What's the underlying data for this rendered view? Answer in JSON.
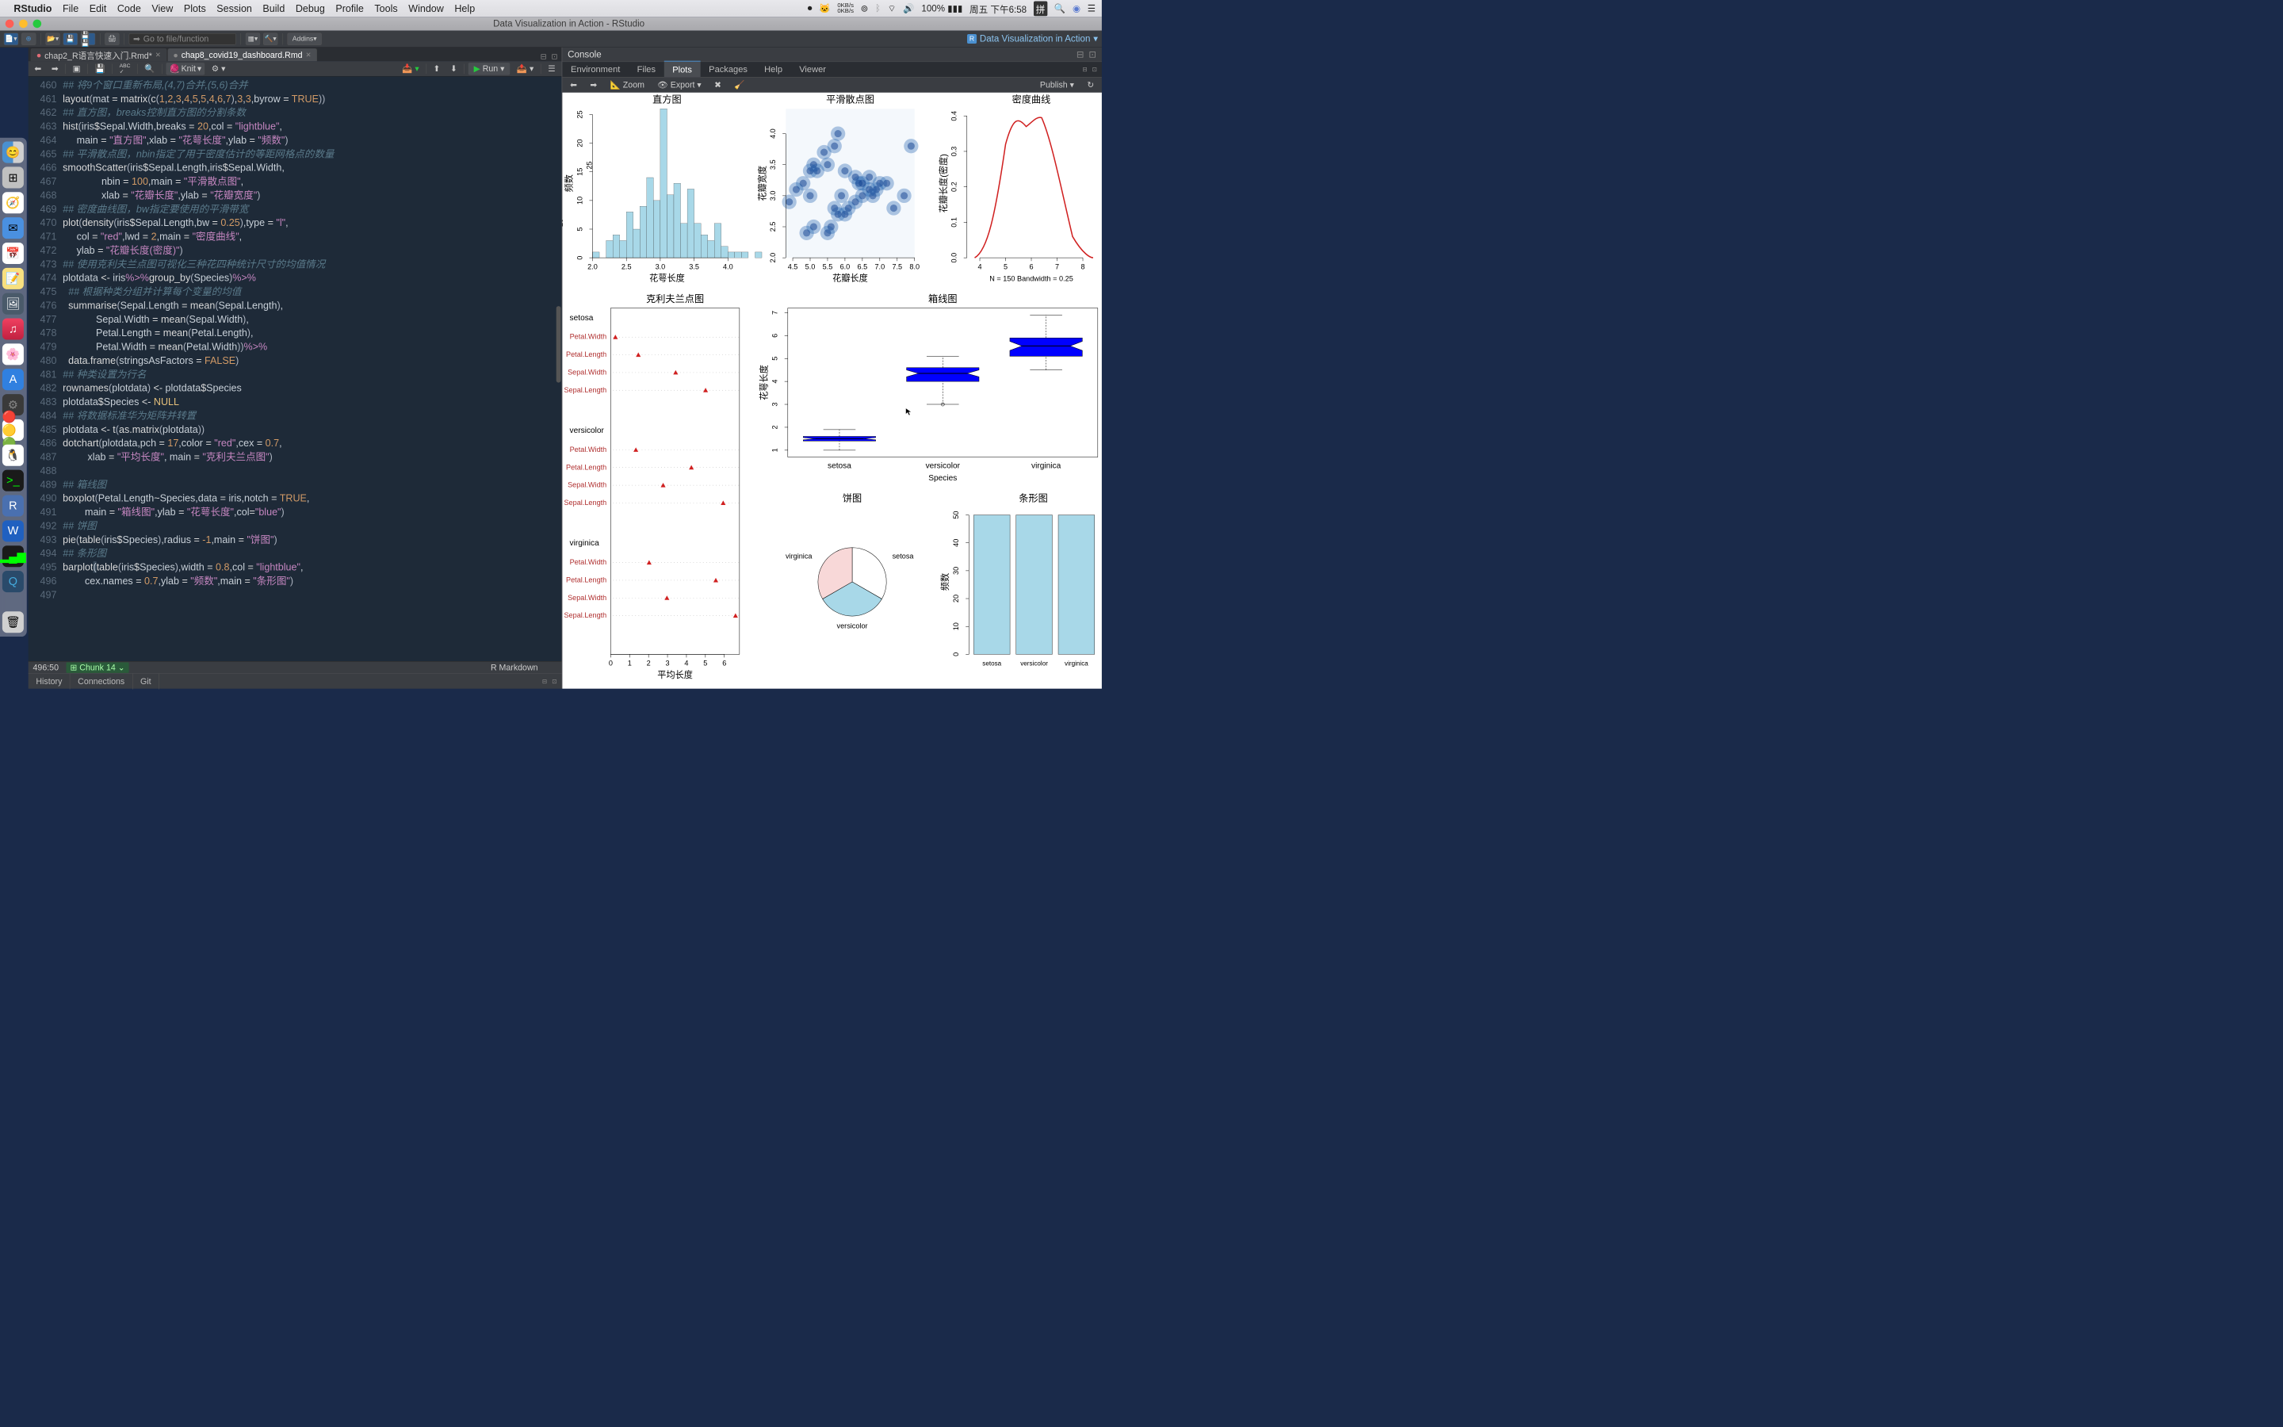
{
  "menubar": {
    "app_name": "RStudio",
    "items": [
      "File",
      "Edit",
      "Code",
      "View",
      "Plots",
      "Session",
      "Build",
      "Debug",
      "Profile",
      "Tools",
      "Window",
      "Help"
    ],
    "status": {
      "net_up": "0KB/s",
      "net_down": "0KB/s",
      "battery": "100%",
      "datetime": "周五 下午6:58",
      "ime": "拼"
    }
  },
  "titlebar": {
    "title": "Data Visualization in Action - RStudio"
  },
  "toolbar": {
    "goto_placeholder": "Go to file/function",
    "addins_label": "Addins",
    "project_label": "Data Visualization in Action"
  },
  "source_tabs": {
    "tab1": "chap2_R语言快速入门.Rmd*",
    "tab2": "chap8_covid19_dashboard.Rmd"
  },
  "editor_toolbar": {
    "knit": "Knit",
    "run": "Run"
  },
  "cursor_pos": "496:50",
  "chunk_label": "Chunk 14",
  "file_lang": "R Markdown",
  "bottom_tabs": [
    "History",
    "Connections",
    "Git"
  ],
  "console": {
    "title": "Console"
  },
  "right_tabs": [
    "Environment",
    "Files",
    "Plots",
    "Packages",
    "Help",
    "Viewer"
  ],
  "plots_toolbar": {
    "zoom": "Zoom",
    "export": "Export",
    "publish": "Publish"
  },
  "code": [
    {
      "n": 460,
      "type": "comment",
      "text": "## 将9个窗口重新布局,(4,7)合并,(5,6)合并"
    },
    {
      "n": 461,
      "html": "<span class='c-func'>layout</span><span class='c-punct'>(</span>mat <span class='c-op'>=</span> <span class='c-func'>matrix</span><span class='c-punct'>(</span><span class='c-func'>c</span><span class='c-punct'>(</span><span class='c-number'>1</span>,<span class='c-number'>2</span>,<span class='c-number'>3</span>,<span class='c-number'>4</span>,<span class='c-number'>5</span>,<span class='c-number'>5</span>,<span class='c-number'>4</span>,<span class='c-number'>6</span>,<span class='c-number'>7</span><span class='c-punct'>)</span>,<span class='c-number'>3</span>,<span class='c-number'>3</span>,byrow <span class='c-op'>=</span> <span class='c-true'>TRUE</span><span class='c-punct'>))</span>"
    },
    {
      "n": 462,
      "type": "comment",
      "text": "## 直方图，breaks控制直方图的分割条数"
    },
    {
      "n": 463,
      "html": "<span class='c-func'>hist</span><span class='c-punct'>(</span>iris<span class='c-op'>$</span>Sepal.Width,breaks <span class='c-op'>=</span> <span class='c-number'>20</span>,col <span class='c-op'>=</span> <span class='c-string'>\"lightblue\"</span>,"
    },
    {
      "n": 464,
      "html": "     main <span class='c-op'>=</span> <span class='c-string'>\"直方图\"</span>,xlab <span class='c-op'>=</span> <span class='c-string'>\"花萼长度\"</span>,ylab <span class='c-op'>=</span> <span class='c-string'>\"频数\"</span><span class='c-punct'>)</span>"
    },
    {
      "n": 465,
      "type": "comment",
      "text": "## 平滑散点图，nbin指定了用于密度估计的等距网格点的数量"
    },
    {
      "n": 466,
      "html": "<span class='c-func'>smoothScatter</span><span class='c-punct'>(</span>iris<span class='c-op'>$</span>Sepal.Length,iris<span class='c-op'>$</span>Sepal.Width,"
    },
    {
      "n": 467,
      "html": "              nbin <span class='c-op'>=</span> <span class='c-number'>100</span>,main <span class='c-op'>=</span> <span class='c-string'>\"平滑散点图\"</span>,"
    },
    {
      "n": 468,
      "html": "              xlab <span class='c-op'>=</span> <span class='c-string'>\"花瓣长度\"</span>,ylab <span class='c-op'>=</span> <span class='c-string'>\"花瓣宽度\"</span><span class='c-punct'>)</span>"
    },
    {
      "n": 469,
      "type": "comment",
      "text": "## 密度曲线图，bw指定要使用的平滑带宽"
    },
    {
      "n": 470,
      "html": "<span class='c-func'>plot</span><span class='c-punct'>(</span><span class='c-func'>density</span><span class='c-punct'>(</span>iris<span class='c-op'>$</span>Sepal.Length,bw <span class='c-op'>=</span> <span class='c-number'>0.25</span><span class='c-punct'>)</span>,type <span class='c-op'>=</span> <span class='c-string'>\"l\"</span>,"
    },
    {
      "n": 471,
      "html": "     col <span class='c-op'>=</span> <span class='c-string'>\"red\"</span>,lwd <span class='c-op'>=</span> <span class='c-number'>2</span>,main <span class='c-op'>=</span> <span class='c-string'>\"密度曲线\"</span>,"
    },
    {
      "n": 472,
      "html": "     ylab <span class='c-op'>=</span> <span class='c-string'>\"花瓣长度(密度)\"</span><span class='c-punct'>)</span>"
    },
    {
      "n": 473,
      "type": "comment",
      "text": "## 使用克利夫兰点图可视化三种花四种统计尺寸的均值情况"
    },
    {
      "n": 474,
      "html": "plotdata <span class='c-op'>&lt;-</span> iris<span class='c-pipe'>%&gt;%</span><span class='c-func'>group_by</span><span class='c-punct'>(</span>Species<span class='c-punct'>)</span><span class='c-pipe'>%&gt;%</span>"
    },
    {
      "n": 475,
      "type": "comment",
      "text": "  ## 根据种类分组并计算每个变量的均值"
    },
    {
      "n": 476,
      "html": "  <span class='c-func'>summarise</span><span class='c-punct'>(</span>Sepal.Length <span class='c-op'>=</span> <span class='c-func'>mean</span><span class='c-punct'>(</span>Sepal.Length<span class='c-punct'>)</span>,"
    },
    {
      "n": 477,
      "html": "            Sepal.Width <span class='c-op'>=</span> <span class='c-func'>mean</span><span class='c-punct'>(</span>Sepal.Width<span class='c-punct'>)</span>,"
    },
    {
      "n": 478,
      "html": "            Petal.Length <span class='c-op'>=</span> <span class='c-func'>mean</span><span class='c-punct'>(</span>Petal.Length<span class='c-punct'>)</span>,"
    },
    {
      "n": 479,
      "html": "            Petal.Width <span class='c-op'>=</span> <span class='c-func'>mean</span><span class='c-punct'>(</span>Petal.Width<span class='c-punct'>))</span><span class='c-pipe'>%&gt;%</span>"
    },
    {
      "n": 480,
      "html": "  <span class='c-func'>data.frame</span><span class='c-punct'>(</span>stringsAsFactors <span class='c-op'>=</span> <span class='c-true'>FALSE</span><span class='c-punct'>)</span>"
    },
    {
      "n": 481,
      "type": "comment",
      "text": "## 种类设置为行名"
    },
    {
      "n": 482,
      "html": "<span class='c-func'>rownames</span><span class='c-punct'>(</span>plotdata<span class='c-punct'>)</span> <span class='c-op'>&lt;-</span> plotdata<span class='c-op'>$</span>Species"
    },
    {
      "n": 483,
      "html": "plotdata<span class='c-op'>$</span>Species <span class='c-op'>&lt;-</span> <span class='c-const'>NULL</span>"
    },
    {
      "n": 484,
      "type": "comment",
      "text": "## 将数据标准华为矩阵并转置"
    },
    {
      "n": 485,
      "html": "plotdata <span class='c-op'>&lt;-</span> <span class='c-func'>t</span><span class='c-punct'>(</span><span class='c-func'>as.matrix</span><span class='c-punct'>(</span>plotdata<span class='c-punct'>))</span>"
    },
    {
      "n": 486,
      "html": "<span class='c-func'>dotchart</span><span class='c-punct'>(</span>plotdata,pch <span class='c-op'>=</span> <span class='c-number'>17</span>,color <span class='c-op'>=</span> <span class='c-string'>\"red\"</span>,cex <span class='c-op'>=</span> <span class='c-number'>0.7</span>,"
    },
    {
      "n": 487,
      "html": "         xlab <span class='c-op'>=</span> <span class='c-string'>\"平均长度\"</span>, main <span class='c-op'>=</span> <span class='c-string'>\"克利夫兰点图\"</span><span class='c-punct'>)</span>"
    },
    {
      "n": 488,
      "html": ""
    },
    {
      "n": 489,
      "type": "comment",
      "text": "## 箱线图"
    },
    {
      "n": 490,
      "html": "<span class='c-func'>boxplot</span><span class='c-punct'>(</span>Petal.Length<span class='c-op'>~</span>Species,data <span class='c-op'>=</span> iris,notch <span class='c-op'>=</span> <span class='c-true'>TRUE</span>,"
    },
    {
      "n": 491,
      "html": "        main <span class='c-op'>=</span> <span class='c-string'>\"箱线图\"</span>,ylab <span class='c-op'>=</span> <span class='c-string'>\"花萼长度\"</span>,col<span class='c-op'>=</span><span class='c-string'>\"blue\"</span><span class='c-punct'>)</span>"
    },
    {
      "n": 492,
      "type": "comment",
      "text": "## 饼图"
    },
    {
      "n": 493,
      "html": "<span class='c-func'>pie</span><span class='c-punct'>(</span><span class='c-func'>table</span><span class='c-punct'>(</span>iris<span class='c-op'>$</span>Species<span class='c-punct'>)</span>,radius <span class='c-op'>=</span> <span class='c-number'>-1</span>,main <span class='c-op'>=</span> <span class='c-string'>\"饼图\"</span><span class='c-punct'>)</span>"
    },
    {
      "n": 494,
      "type": "comment",
      "text": "## 条形图"
    },
    {
      "n": 495,
      "html": "<span class='c-func'>barplot</span><span style='background:#3a4a5a'>(</span><span class='c-func'>table</span><span class='c-punct'>(</span>iris<span class='c-op'>$</span>Species<span class='c-punct'>)</span>,width <span class='c-op'>=</span> <span class='c-number'>0.8</span>,col <span class='c-op'>=</span> <span class='c-string'>\"lightblue\"</span>,"
    },
    {
      "n": 496,
      "html": "        cex.names <span class='c-op'>=</span> <span class='c-number'>0.7</span>,ylab <span class='c-op'>=</span> <span class='c-string'>\"频数\"</span>,main <span class='c-op'>=</span> <span class='c-string'>\"条形图\"</span><span class='c-punct'>)</span>"
    },
    {
      "n": 497,
      "html": ""
    }
  ],
  "chart_data": [
    {
      "type": "histogram",
      "title": "直方图",
      "xlabel": "花萼长度",
      "ylabel": "频数",
      "x_ticks": [
        2.0,
        2.5,
        3.0,
        3.5,
        4.0
      ],
      "y_ticks": [
        0,
        5,
        10,
        15,
        20,
        25
      ],
      "xlim": [
        2.0,
        4.2
      ],
      "ylim": [
        0,
        26
      ],
      "bins": [
        {
          "x": 2.0,
          "y": 1
        },
        {
          "x": 2.2,
          "y": 3
        },
        {
          "x": 2.3,
          "y": 4
        },
        {
          "x": 2.4,
          "y": 3
        },
        {
          "x": 2.5,
          "y": 8
        },
        {
          "x": 2.6,
          "y": 5
        },
        {
          "x": 2.7,
          "y": 9
        },
        {
          "x": 2.8,
          "y": 14
        },
        {
          "x": 2.9,
          "y": 10
        },
        {
          "x": 3.0,
          "y": 26
        },
        {
          "x": 3.1,
          "y": 11
        },
        {
          "x": 3.2,
          "y": 13
        },
        {
          "x": 3.3,
          "y": 6
        },
        {
          "x": 3.4,
          "y": 12
        },
        {
          "x": 3.5,
          "y": 6
        },
        {
          "x": 3.6,
          "y": 4
        },
        {
          "x": 3.7,
          "y": 3
        },
        {
          "x": 3.8,
          "y": 6
        },
        {
          "x": 3.9,
          "y": 2
        },
        {
          "x": 4.0,
          "y": 1
        },
        {
          "x": 4.1,
          "y": 1
        },
        {
          "x": 4.2,
          "y": 1
        },
        {
          "x": 4.4,
          "y": 1
        }
      ],
      "color": "#a8d8e8"
    },
    {
      "type": "smoothscatter",
      "title": "平滑散点图",
      "xlabel": "花瓣长度",
      "ylabel": "花瓣宽度",
      "x_ticks": [
        4.5,
        5.0,
        5.5,
        6.0,
        6.5,
        7.0,
        7.5,
        8.0
      ],
      "y_ticks": [
        2.0,
        2.5,
        3.0,
        3.5,
        4.0
      ],
      "xlim": [
        4.3,
        8.0
      ],
      "ylim": [
        2.0,
        4.4
      ]
    },
    {
      "type": "density",
      "title": "密度曲线",
      "xlabel": "",
      "ylabel": "花瓣长度(密度)",
      "x_ticks": [
        4,
        5,
        6,
        7,
        8
      ],
      "y_ticks": [
        0.0,
        0.1,
        0.2,
        0.3,
        0.4
      ],
      "annotation": "N = 150   Bandwidth = 0.25",
      "color": "#d02020"
    },
    {
      "type": "dotchart",
      "title": "克利夫兰点图",
      "xlabel": "平均长度",
      "x_ticks": [
        0,
        1,
        2,
        3,
        4,
        5,
        6
      ],
      "groups": [
        {
          "name": "setosa",
          "items": [
            {
              "label": "Petal.Width",
              "value": 0.25
            },
            {
              "label": "Petal.Length",
              "value": 1.46
            },
            {
              "label": "Sepal.Width",
              "value": 3.43
            },
            {
              "label": "Sepal.Length",
              "value": 5.01
            }
          ]
        },
        {
          "name": "versicolor",
          "items": [
            {
              "label": "Petal.Width",
              "value": 1.33
            },
            {
              "label": "Petal.Length",
              "value": 4.26
            },
            {
              "label": "Sepal.Width",
              "value": 2.77
            },
            {
              "label": "Sepal.Length",
              "value": 5.94
            }
          ]
        },
        {
          "name": "virginica",
          "items": [
            {
              "label": "Petal.Width",
              "value": 2.03
            },
            {
              "label": "Petal.Length",
              "value": 5.55
            },
            {
              "label": "Sepal.Width",
              "value": 2.97
            },
            {
              "label": "Sepal.Length",
              "value": 6.59
            }
          ]
        }
      ],
      "color": "#d02020"
    },
    {
      "type": "boxplot",
      "title": "箱线图",
      "xlabel": "Species",
      "ylabel": "花萼长度",
      "categories": [
        "setosa",
        "versicolor",
        "virginica"
      ],
      "y_ticks": [
        1,
        2,
        3,
        4,
        5,
        6,
        7
      ],
      "series": [
        {
          "name": "setosa",
          "min": 1.0,
          "q1": 1.4,
          "median": 1.5,
          "q3": 1.6,
          "max": 1.9
        },
        {
          "name": "versicolor",
          "min": 3.0,
          "q1": 4.0,
          "median": 4.35,
          "q3": 4.6,
          "max": 5.1,
          "outliers": [
            3.0
          ]
        },
        {
          "name": "virginica",
          "min": 4.5,
          "q1": 5.1,
          "median": 5.55,
          "q3": 5.9,
          "max": 6.9
        }
      ],
      "color": "#0000ff"
    },
    {
      "type": "pie",
      "title": "饼图",
      "slices": [
        {
          "name": "setosa",
          "value": 50,
          "color": "#ffffff"
        },
        {
          "name": "versicolor",
          "value": 50,
          "color": "#a8d8e8"
        },
        {
          "name": "virginica",
          "value": 50,
          "color": "#f8d8d8"
        }
      ]
    },
    {
      "type": "bar",
      "title": "条形图",
      "ylabel": "频数",
      "categories": [
        "setosa",
        "versicolor",
        "virginica"
      ],
      "values": [
        50,
        50,
        50
      ],
      "y_ticks": [
        0,
        10,
        20,
        30,
        40,
        50
      ],
      "color": "#a8d8e8"
    }
  ]
}
